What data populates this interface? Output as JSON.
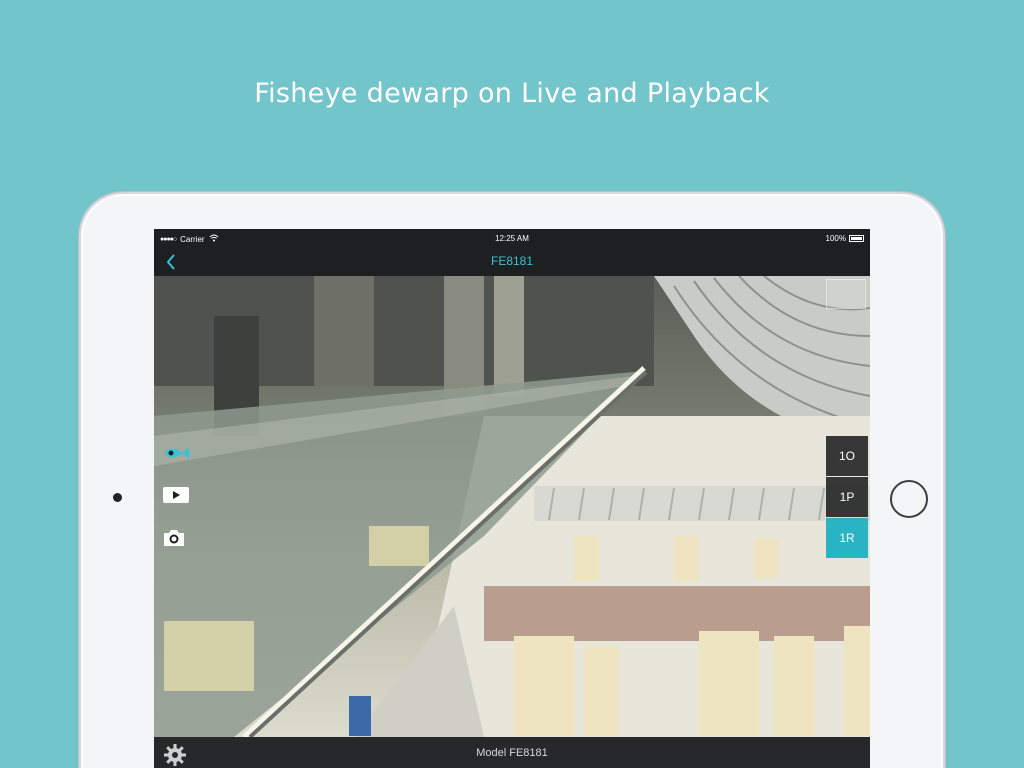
{
  "headline": "Fisheye dewarp on Live and Playback",
  "statusbar": {
    "signal": "●●●●○",
    "carrier": "Carrier",
    "time": "12:25 AM",
    "battery": "100%"
  },
  "navbar": {
    "title": "FE8181",
    "back_icon": "chevron-left-icon"
  },
  "side_tools": [
    {
      "name": "fisheye-icon"
    },
    {
      "name": "play-icon"
    },
    {
      "name": "camera-icon"
    }
  ],
  "view_modes": [
    {
      "label": "1O",
      "active": false
    },
    {
      "label": "1P",
      "active": false
    },
    {
      "label": "1R",
      "active": true
    }
  ],
  "footer": {
    "model": "Model FE8181",
    "settings_icon": "gear-icon"
  },
  "colors": {
    "background": "#72c5cb",
    "accent": "#2ab3c2",
    "title": "#39c3d4"
  }
}
